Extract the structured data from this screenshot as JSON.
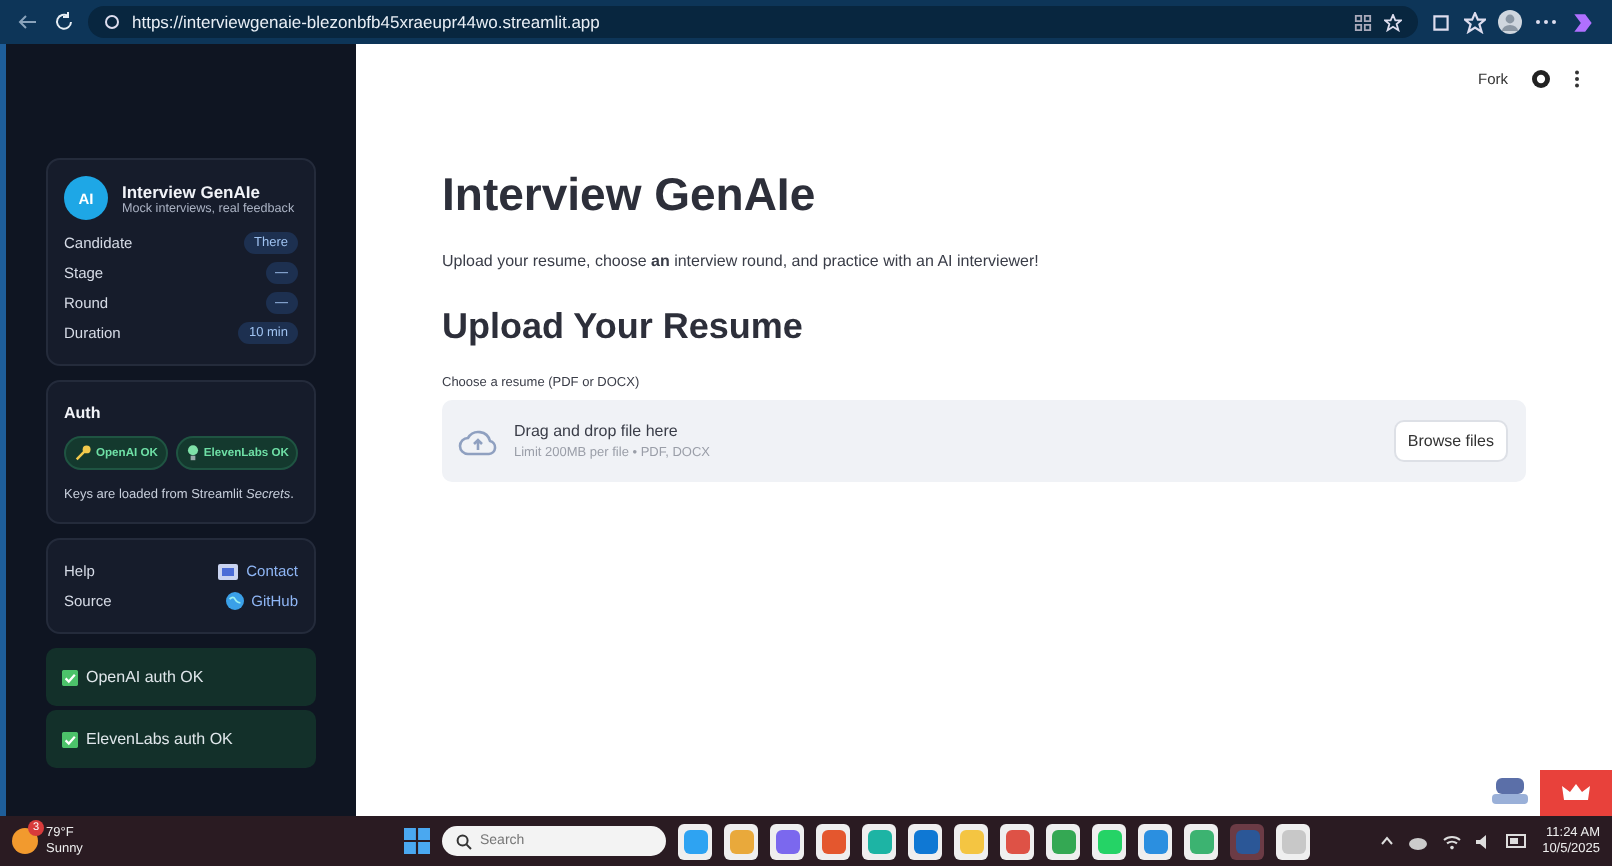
{
  "browser": {
    "url": "https://interviewgenaie-blezonbfb45xraeupr44wo.streamlit.app"
  },
  "sidebar": {
    "profile": {
      "avatar": "AI",
      "title": "Interview GenAIe",
      "subtitle": "Mock interviews, real feedback",
      "rows": [
        {
          "label": "Candidate",
          "value": "There"
        },
        {
          "label": "Stage",
          "value": "—"
        },
        {
          "label": "Round",
          "value": "—"
        },
        {
          "label": "Duration",
          "value": "10 min"
        }
      ]
    },
    "auth": {
      "title": "Auth",
      "badges": [
        {
          "kind": "key",
          "label": "OpenAI OK"
        },
        {
          "kind": "bulb",
          "label": "ElevenLabs OK"
        }
      ],
      "note": "Keys are loaded from Streamlit *Secrets*."
    },
    "links": [
      {
        "label": "Help",
        "kind": "mail",
        "link": "Contact"
      },
      {
        "label": "Source",
        "kind": "globe",
        "link": "GitHub"
      }
    ],
    "alerts": [
      {
        "checked": true,
        "text": "OpenAI auth OK"
      },
      {
        "checked": true,
        "text": "ElevenLabs auth OK"
      }
    ]
  },
  "header": {
    "fork": "Fork"
  },
  "main": {
    "title": "Interview GenAIe",
    "intro": "Upload your resume, choose **an** interview round, and practice with an AI interviewer!",
    "section": "Upload Your Resume",
    "uploader": {
      "label": "Choose a resume (PDF or DOCX)",
      "drop": "Drag and drop file here",
      "limit": "Limit 200MB per file • PDF, DOCX",
      "button": "Browse files"
    }
  },
  "taskbar": {
    "weather": {
      "temp": "79°F",
      "condition": "Sunny",
      "badge": "3"
    },
    "search": {
      "placeholder": "Search"
    },
    "time": "11:24 AM",
    "date": "10/5/2025",
    "apps": [
      {
        "color": "#2ea3f2",
        "active": false
      },
      {
        "color": "#e9a93b",
        "active": false
      },
      {
        "color": "#7b68ee",
        "active": false
      },
      {
        "color": "#e4572e",
        "active": false
      },
      {
        "color": "#1db4a4",
        "active": false
      },
      {
        "color": "#0f78d4",
        "active": false
      },
      {
        "color": "#f4c542",
        "active": false
      },
      {
        "color": "#de5246",
        "active": false
      },
      {
        "color": "#34a853",
        "active": false
      },
      {
        "color": "#25d366",
        "active": false
      },
      {
        "color": "#2b8fe0",
        "active": false
      },
      {
        "color": "#3cb371",
        "active": false
      },
      {
        "color": "#2b5797",
        "active": true
      },
      {
        "color": "#c8c8c8",
        "active": false
      }
    ]
  }
}
